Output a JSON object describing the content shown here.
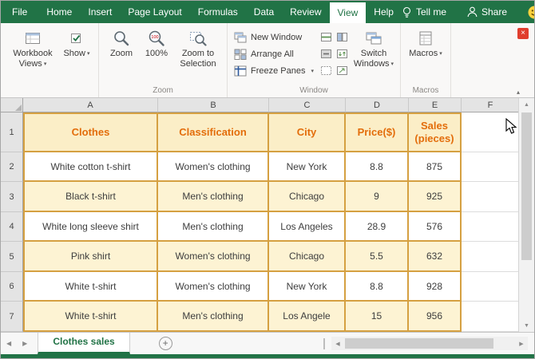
{
  "menubar": {
    "tabs": [
      {
        "label": "File"
      },
      {
        "label": "Home"
      },
      {
        "label": "Insert"
      },
      {
        "label": "Page Layout"
      },
      {
        "label": "Formulas"
      },
      {
        "label": "Data"
      },
      {
        "label": "Review"
      },
      {
        "label": "View"
      },
      {
        "label": "Help"
      }
    ],
    "active_tab": "View",
    "tell_me": "Tell me",
    "share": "Share"
  },
  "ribbon": {
    "buttons": {
      "workbook_views": "Workbook Views",
      "show": "Show",
      "zoom": "Zoom",
      "zoom_100": "100%",
      "zoom_to_selection": "Zoom to Selection",
      "new_window": "New Window",
      "arrange_all": "Arrange All",
      "freeze_panes": "Freeze Panes",
      "switch_windows": "Switch Windows",
      "macros": "Macros"
    },
    "group_labels": {
      "zoom": "Zoom",
      "window": "Window",
      "macros": "Macros"
    }
  },
  "grid": {
    "column_headers": [
      "A",
      "B",
      "C",
      "D",
      "E",
      "F"
    ],
    "row_headers": [
      "1",
      "2",
      "3",
      "4",
      "5",
      "6",
      "7"
    ]
  },
  "table": {
    "headers": [
      "Clothes",
      "Classification",
      "City",
      "Price($)",
      "Sales (pieces)"
    ],
    "rows": [
      [
        "White cotton t-shirt",
        "Women's clothing",
        "New York",
        "8.8",
        "875"
      ],
      [
        "Black t-shirt",
        "Men's clothing",
        "Chicago",
        "9",
        "925"
      ],
      [
        "White long sleeve shirt",
        "Men's clothing",
        "Los Angeles",
        "28.9",
        "576"
      ],
      [
        "Pink shirt",
        "Women's clothing",
        "Chicago",
        "5.5",
        "632"
      ],
      [
        "White t-shirt",
        "Women's clothing",
        "New York",
        "8.8",
        "928"
      ],
      [
        "White t-shirt",
        "Men's clothing",
        "Los Angele",
        "15",
        "956"
      ]
    ]
  },
  "sheet_tabs": {
    "active": "Clothes sales"
  },
  "icons": {
    "dropdown_caret": "▾",
    "collapse_ribbon": "▴",
    "close": "×",
    "scroll_up": "▲",
    "scroll_down": "▼",
    "scroll_left": "◀",
    "scroll_right": "▶",
    "tab_nav_left": "◀",
    "tab_nav_right": "▶",
    "new_sheet": "+",
    "tell_me_icon": "lightbulb",
    "share_icon": "person",
    "smiley_icon": "smiley-face",
    "zoom_icon": "magnifier",
    "cursor_icon": "mouse-arrow"
  },
  "colors": {
    "excel_green": "#217346",
    "header_orange": "#e36d0b",
    "table_border_gold": "#d5a041",
    "row_fill_yellow": "#fdf3d3",
    "header_fill": "#fbeec7"
  }
}
